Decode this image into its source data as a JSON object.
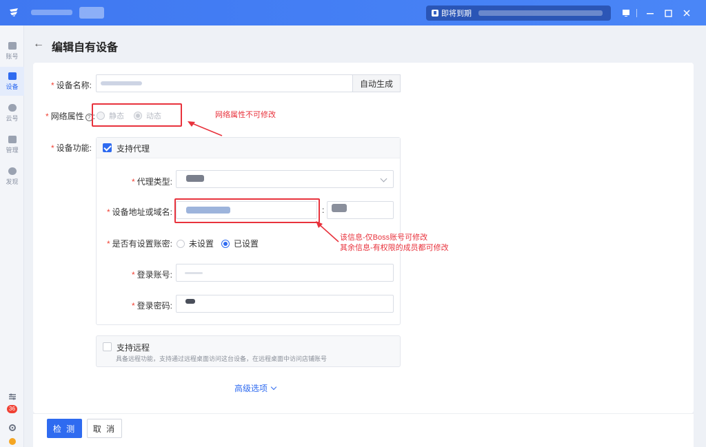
{
  "window": {
    "expire_label": "即将到期"
  },
  "sidebar": {
    "items": [
      {
        "label": "账号",
        "icon": "store-icon"
      },
      {
        "label": "设备",
        "icon": "device-icon"
      },
      {
        "label": "云号",
        "icon": "cloud-icon"
      },
      {
        "label": "管理",
        "icon": "manage-icon"
      },
      {
        "label": "发现",
        "icon": "compass-icon"
      }
    ],
    "badge_count": "36"
  },
  "page": {
    "title": "编辑自有设备"
  },
  "form": {
    "device_name_label": "设备名称:",
    "auto_generate_label": "自动生成",
    "network_attr_label": "网络属性",
    "static_label": "静态",
    "dynamic_label": "动态",
    "device_function_label": "设备功能:",
    "support_proxy_label": "支持代理",
    "proxy_type_label": "代理类型:",
    "address_label": "设备地址或域名:",
    "has_password_label": "是否有设置账密:",
    "not_set_label": "未设置",
    "set_label": "已设置",
    "login_account_label": "登录账号:",
    "login_password_label": "登录密码:",
    "support_remote_label": "支持远程",
    "remote_desc": "具备远程功能，支持通过远程桌面访问这台设备，在远程桌面中访问店铺账号",
    "advanced_label": "高级选项"
  },
  "annotations": {
    "note1": "网络属性不可修改",
    "note2_line1": "该信息-仅Boss账号可修改",
    "note2_line2": "其余信息-有权限的成员都可修改"
  },
  "footer": {
    "detect_label": "检 测",
    "cancel_label": "取 消"
  },
  "colors": {
    "primary": "#2f6bf0",
    "title_bar": "#4a86f7",
    "annotation": "#e8323c"
  }
}
